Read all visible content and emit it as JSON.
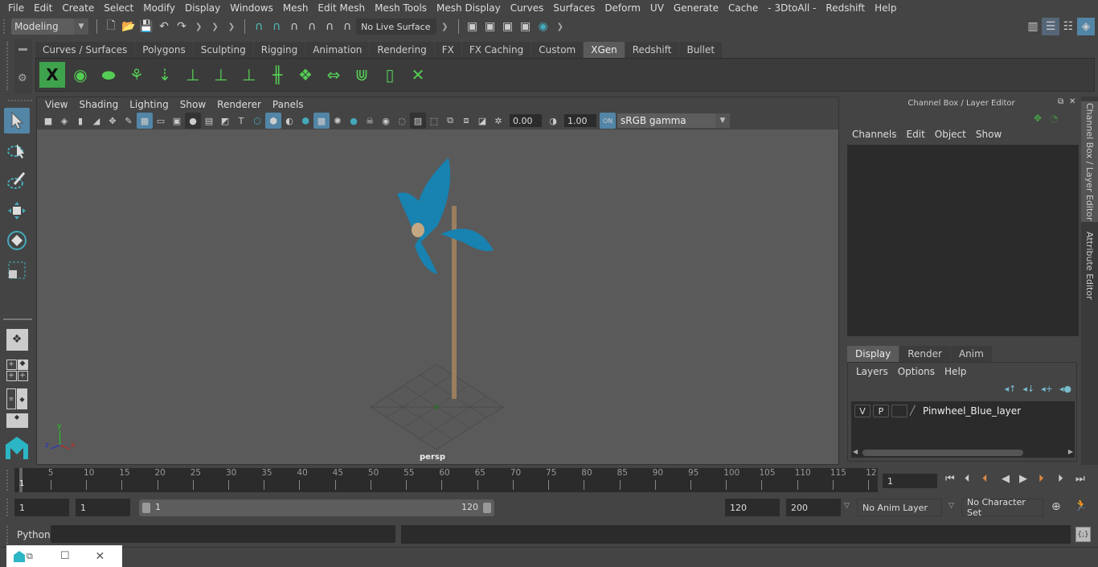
{
  "menubar": [
    "File",
    "Edit",
    "Create",
    "Select",
    "Modify",
    "Display",
    "Windows",
    "Mesh",
    "Edit Mesh",
    "Mesh Tools",
    "Mesh Display",
    "Curves",
    "Surfaces",
    "Deform",
    "UV",
    "Generate",
    "Cache",
    "- 3DtoAll -",
    "Redshift",
    "Help"
  ],
  "statusline": {
    "mode": "Modeling",
    "live_surface": "No Live Surface"
  },
  "shelf": {
    "tabs": [
      "Curves / Surfaces",
      "Polygons",
      "Sculpting",
      "Rigging",
      "Animation",
      "Rendering",
      "FX",
      "FX Caching",
      "Custom",
      "XGen",
      "Redshift",
      "Bullet"
    ],
    "active_tab": "XGen",
    "icons": [
      "xgen-editor-icon",
      "preview-icon",
      "clear-preview-icon",
      "add-guides-icon",
      "place-guides-icon",
      "add-guide-icon",
      "show-guides-icon",
      "lock-guides-icon",
      "split-guides-icon",
      "grid-icon",
      "flip-guides-icon",
      "select-guides-icon",
      "guide-box-icon",
      "delete-guides-icon"
    ]
  },
  "viewport": {
    "menu": [
      "View",
      "Shading",
      "Lighting",
      "Show",
      "Renderer",
      "Panels"
    ],
    "exposure": "0.00",
    "gamma": "1.00",
    "colorspace": "sRGB gamma",
    "camera_label": "persp",
    "axis": {
      "x": "x",
      "y": "y",
      "z": "z"
    }
  },
  "channelbox": {
    "title": "Channel Box / Layer Editor",
    "menu": [
      "Channels",
      "Edit",
      "Object",
      "Show"
    ],
    "layer_tabs": [
      "Display",
      "Render",
      "Anim"
    ],
    "active_layer_tab": "Display",
    "layer_menu": [
      "Layers",
      "Options",
      "Help"
    ],
    "layers": [
      {
        "v": "V",
        "p": "P",
        "name": "Pinwheel_Blue_layer"
      }
    ]
  },
  "side_tabs": [
    "Channel Box / Layer Editor",
    "Attribute Editor"
  ],
  "timeline": {
    "ticks": [
      "5",
      "10",
      "15",
      "20",
      "25",
      "30",
      "35",
      "40",
      "45",
      "50",
      "55",
      "60",
      "65",
      "70",
      "75",
      "80",
      "85",
      "90",
      "95",
      "100",
      "105",
      "110",
      "115",
      "12"
    ],
    "current_marker": "1",
    "current_frame": "1"
  },
  "range": {
    "start": "1",
    "anim_start": "1",
    "slider_start": "1",
    "slider_end": "120",
    "end": "120",
    "anim_end": "200",
    "anim_layer": "No Anim Layer",
    "character_set": "No Character Set"
  },
  "cmdline": {
    "label": "Python"
  }
}
